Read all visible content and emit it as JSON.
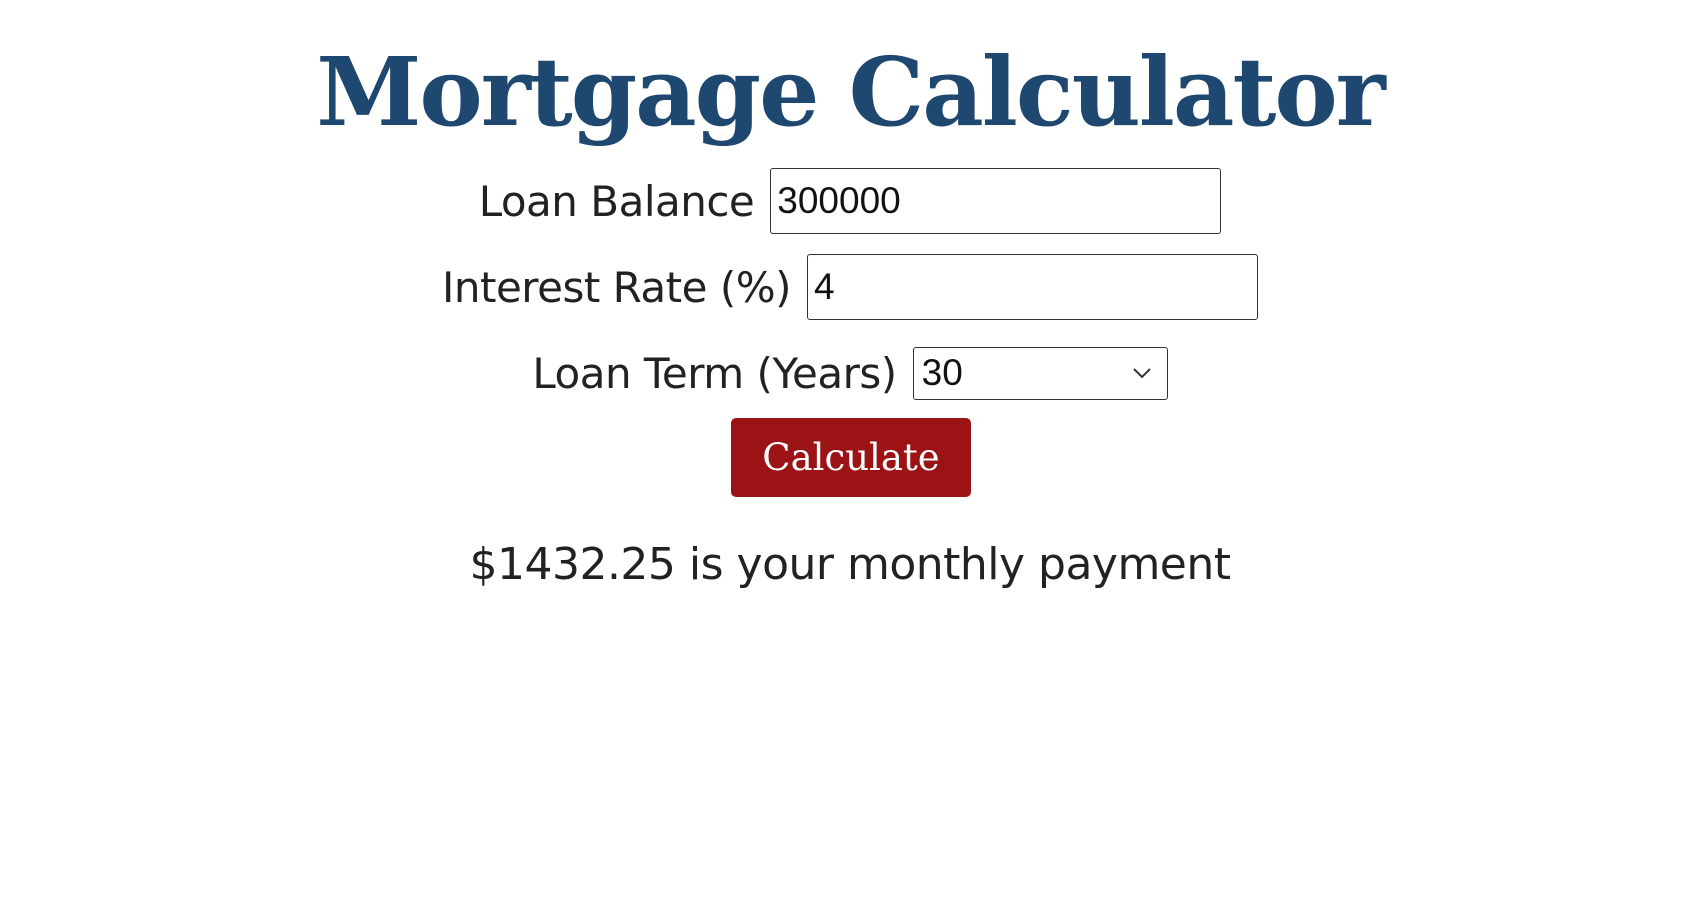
{
  "header": {
    "title": "Mortgage Calculator"
  },
  "form": {
    "loan_balance": {
      "label": "Loan Balance",
      "value": "300000"
    },
    "interest_rate": {
      "label": "Interest Rate (%)",
      "value": "4"
    },
    "loan_term": {
      "label": "Loan Term (Years)",
      "selected": "30",
      "icon": "chevron-down-icon"
    },
    "submit_label": "Calculate"
  },
  "result": {
    "text": "$1432.25 is your monthly payment"
  },
  "colors": {
    "title": "#1f4870",
    "button_bg": "#9b1314",
    "button_text": "#ffffff",
    "text": "#222222",
    "background": "#ffffff"
  }
}
